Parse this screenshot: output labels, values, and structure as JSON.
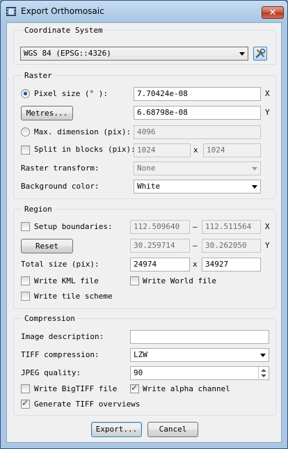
{
  "window": {
    "title": "Export Orthomosaic",
    "close_label": "✕",
    "icon": "film-icon"
  },
  "coordinate_system": {
    "group_title": "Coordinate System",
    "value": "WGS 84 (EPSG::4326)",
    "settings_icon": "tools-icon"
  },
  "raster": {
    "group_title": "Raster",
    "pixel_size_label": "Pixel size (° ):",
    "pixel_size_x": "7.70424e-08",
    "pixel_size_y": "6.68798e-08",
    "metres_button": "Metres...",
    "max_dimension_label": "Max. dimension (pix):",
    "max_dimension_value": "4096",
    "split_blocks_label": "Split in blocks (pix):",
    "split_blocks_x": "1024",
    "split_blocks_y": "1024",
    "raster_transform_label": "Raster transform:",
    "raster_transform_value": "None",
    "background_color_label": "Background color:",
    "background_color_value": "White",
    "x_axis": "X",
    "y_axis": "Y",
    "times": "x"
  },
  "region": {
    "group_title": "Region",
    "setup_boundaries_label": "Setup boundaries:",
    "x_min": "112.509640",
    "x_max": "112.511564",
    "y_min": "30.259714",
    "y_max": "30.262050",
    "dash": "–",
    "reset_button": "Reset",
    "total_size_label": "Total size (pix):",
    "total_w": "24974",
    "total_h": "34927",
    "write_kml_label": "Write KML file",
    "write_world_label": "Write World file",
    "write_tile_label": "Write tile scheme",
    "x_axis": "X",
    "y_axis": "Y",
    "times": "x"
  },
  "compression": {
    "group_title": "Compression",
    "image_description_label": "Image description:",
    "image_description_value": "",
    "tiff_compression_label": "TIFF compression:",
    "tiff_compression_value": "LZW",
    "jpeg_quality_label": "JPEG quality:",
    "jpeg_quality_value": "90",
    "write_bigtiff_label": "Write BigTIFF file",
    "write_alpha_label": "Write alpha channel",
    "generate_overviews_label": "Generate TIFF overviews",
    "check_mark": "✓"
  },
  "buttons": {
    "export": "Export...",
    "cancel": "Cancel"
  }
}
